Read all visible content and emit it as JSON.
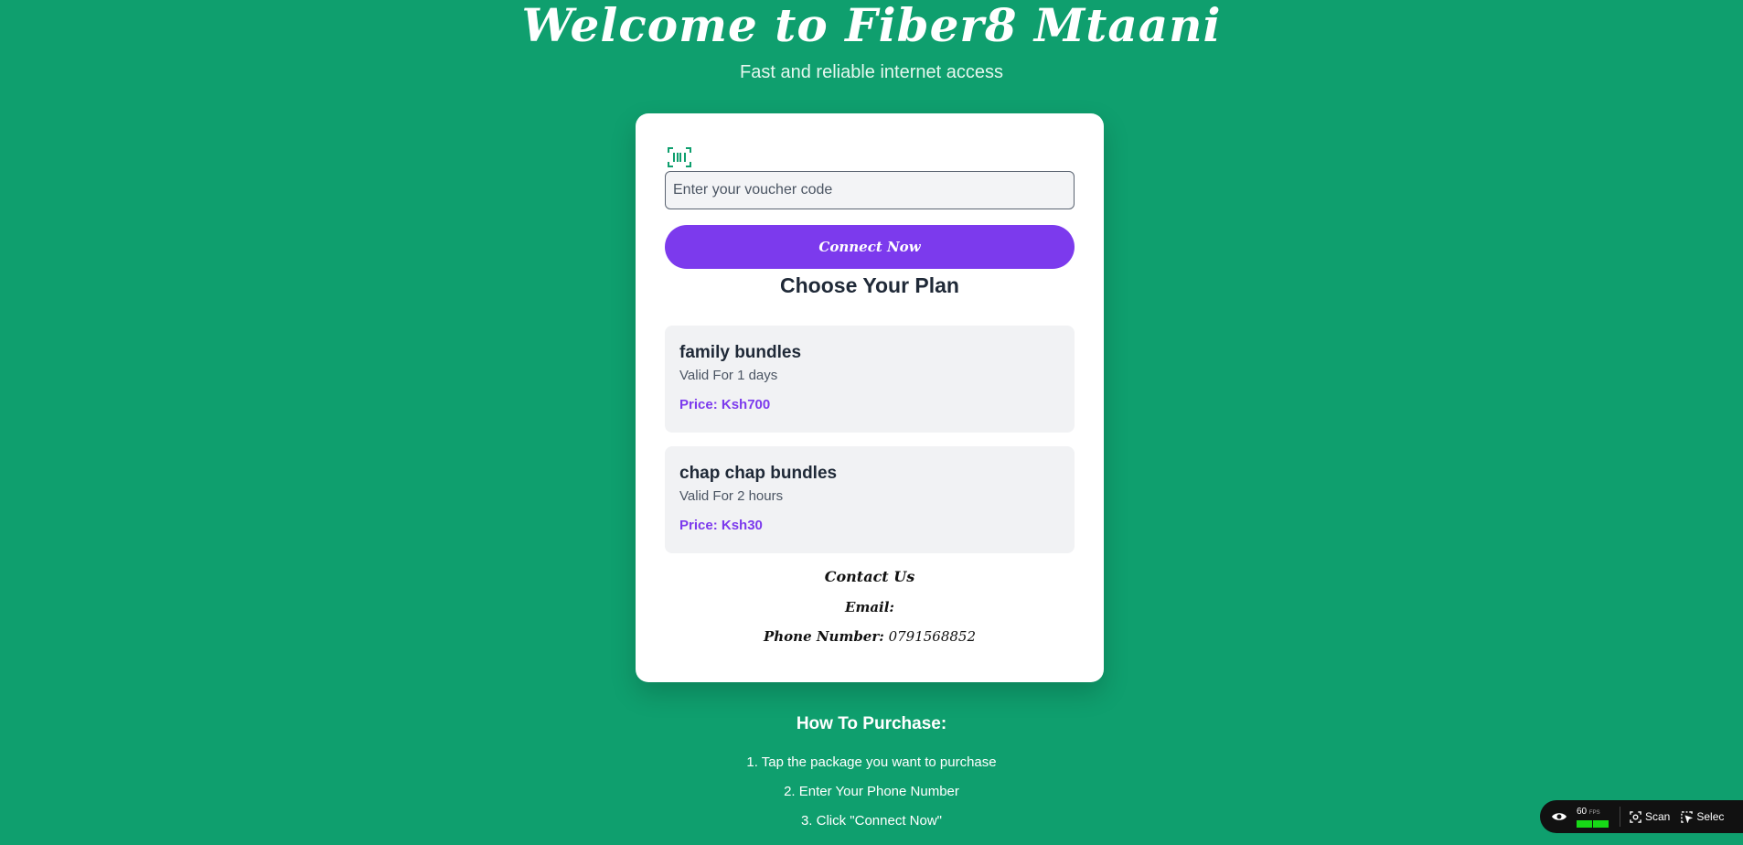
{
  "header": {
    "title": "Welcome to Fiber8 Mtaani",
    "subtitle": "Fast and reliable internet access"
  },
  "voucher": {
    "icon": "barcode-icon",
    "placeholder": "Enter your voucher code",
    "value": "",
    "button_label": "Connect Now"
  },
  "plans": {
    "heading": "Choose Your Plan",
    "items": [
      {
        "name": "family bundles",
        "validity": "Valid For 1 days",
        "price": "Price: Ksh700"
      },
      {
        "name": "chap chap bundles",
        "validity": "Valid For 2 hours",
        "price": "Price: Ksh30"
      }
    ]
  },
  "contact": {
    "heading": "Contact Us",
    "email_label": "Email:",
    "phone_label": "Phone Number:",
    "phone_value": "0791568852"
  },
  "how_to": {
    "heading": "How To Purchase:",
    "steps": [
      "1. Tap the package you want to purchase",
      "2. Enter Your Phone Number",
      "3. Click \"Connect Now\""
    ]
  },
  "devtool": {
    "fps_value": "60",
    "fps_unit": "FPS",
    "scan_label": "Scan",
    "select_label": "Selec"
  },
  "colors": {
    "background": "#0f9f6e",
    "accent": "#7c3aed",
    "card": "#ffffff",
    "plan_card": "#f1f2f4"
  }
}
